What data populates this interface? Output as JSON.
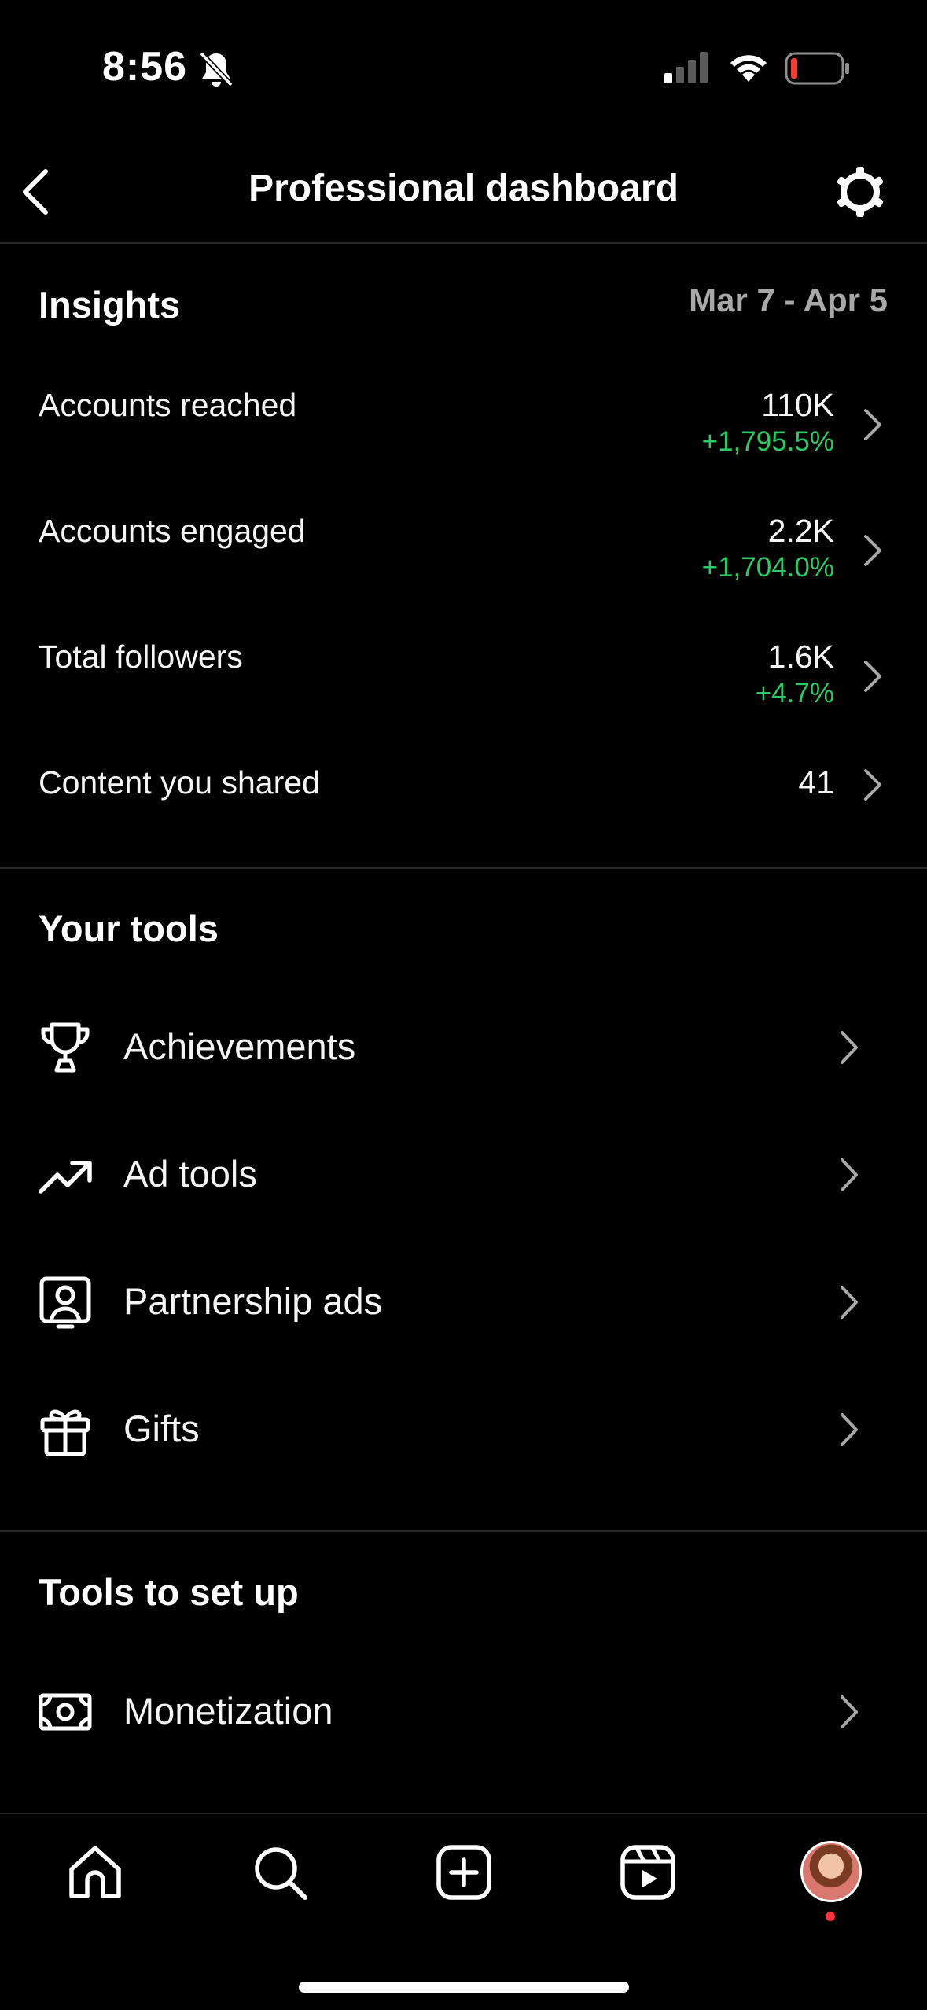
{
  "status_bar": {
    "time": "8:56"
  },
  "header": {
    "title": "Professional dashboard"
  },
  "insights": {
    "title": "Insights",
    "date_range": "Mar 7 - Apr 5",
    "metrics": [
      {
        "label": "Accounts reached",
        "value": "110K",
        "change": "+1,795.5%"
      },
      {
        "label": "Accounts engaged",
        "value": "2.2K",
        "change": "+1,704.0%"
      },
      {
        "label": "Total followers",
        "value": "1.6K",
        "change": "+4.7%"
      },
      {
        "label": "Content you shared",
        "value": "41",
        "change": ""
      }
    ]
  },
  "your_tools": {
    "title": "Your tools",
    "items": [
      {
        "label": "Achievements",
        "icon": "trophy-icon"
      },
      {
        "label": "Ad tools",
        "icon": "trending-up-icon"
      },
      {
        "label": "Partnership ads",
        "icon": "person-frame-icon"
      },
      {
        "label": "Gifts",
        "icon": "gift-icon"
      }
    ]
  },
  "tools_to_set_up": {
    "title": "Tools to set up",
    "items": [
      {
        "label": "Monetization",
        "icon": "money-icon"
      }
    ]
  },
  "tab_bar": {
    "items": [
      "home-icon",
      "search-icon",
      "create-icon",
      "reels-icon",
      "profile-avatar"
    ]
  },
  "colors": {
    "background": "#000000",
    "positive_change": "#2ec866",
    "secondary_text": "#a8a8a8",
    "notification_dot": "#ff3040"
  }
}
